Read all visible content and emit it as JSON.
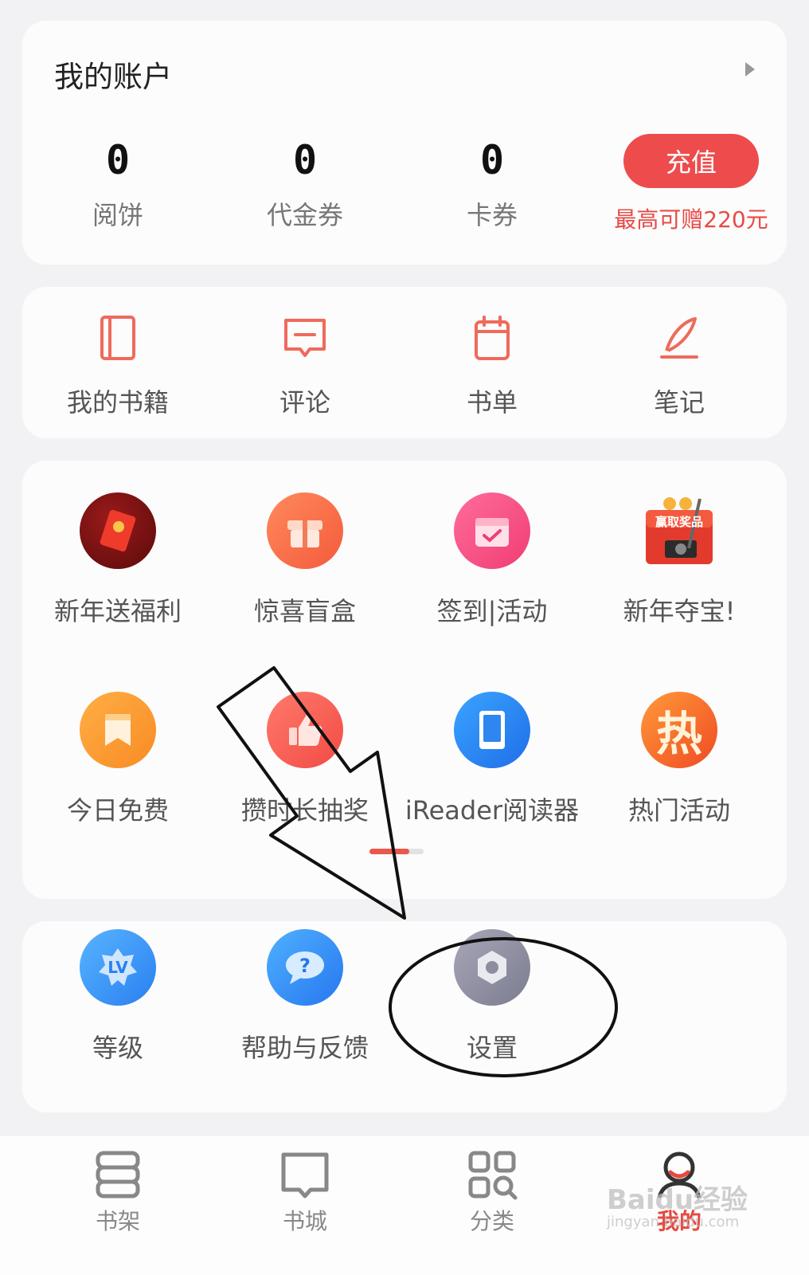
{
  "account": {
    "title": "我的账户",
    "stats": [
      {
        "value": "0",
        "label": "阅饼"
      },
      {
        "value": "0",
        "label": "代金券"
      },
      {
        "value": "0",
        "label": "卡券"
      }
    ],
    "recharge_label": "充值",
    "recharge_note": "最高可赠220元"
  },
  "shortcuts": [
    {
      "label": "我的书籍",
      "icon": "book-icon"
    },
    {
      "label": "评论",
      "icon": "comment-icon"
    },
    {
      "label": "书单",
      "icon": "booklist-icon"
    },
    {
      "label": "笔记",
      "icon": "note-icon"
    }
  ],
  "activities": [
    {
      "label": "新年送福利",
      "icon": "red-envelope-icon"
    },
    {
      "label": "惊喜盲盒",
      "icon": "gift-box-icon"
    },
    {
      "label": "签到|活动",
      "icon": "calendar-check-icon"
    },
    {
      "label": "新年夺宝!",
      "icon": "prize-icon"
    },
    {
      "label": "今日免费",
      "icon": "bookmark-icon"
    },
    {
      "label": "攒时长抽奖",
      "icon": "thumbs-up-icon"
    },
    {
      "label": "iReader阅读器",
      "icon": "tablet-icon"
    },
    {
      "label": "热门活动",
      "icon": "hot-icon"
    }
  ],
  "prize_badge": "赢取奖品",
  "hot_glyph": "热",
  "tools": [
    {
      "label": "等级",
      "icon": "level-icon"
    },
    {
      "label": "帮助与反馈",
      "icon": "help-icon"
    },
    {
      "label": "设置",
      "icon": "settings-icon"
    }
  ],
  "level_badge": "LV",
  "nav": [
    {
      "label": "书架",
      "icon": "bookshelf-icon"
    },
    {
      "label": "书城",
      "icon": "bookstore-icon"
    },
    {
      "label": "分类",
      "icon": "category-icon"
    },
    {
      "label": "我的",
      "icon": "profile-icon"
    }
  ],
  "watermark": {
    "main": "Baidu经验",
    "sub": "jingyan.baidu.com"
  },
  "colors": {
    "accent": "#e8493f",
    "recharge": "#ee4c4c"
  }
}
